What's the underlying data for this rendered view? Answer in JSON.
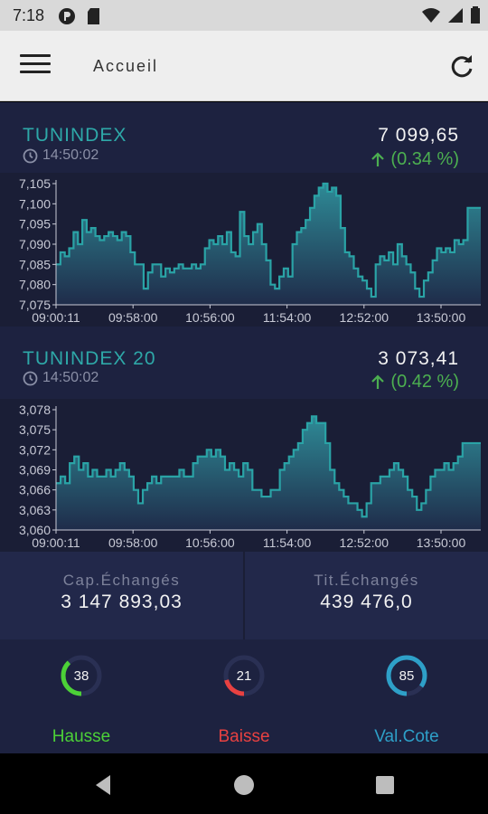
{
  "status_bar": {
    "time": "7:18",
    "icons": [
      "pocket-icon",
      "sd-card-icon",
      "wifi-icon",
      "signal-icon",
      "battery-icon"
    ]
  },
  "app_bar": {
    "title": "Accueil",
    "menu_icon": "menu-icon",
    "refresh_icon": "refresh-icon"
  },
  "indices": [
    {
      "name": "TUNINDEX",
      "time": "14:50:02",
      "value": "7 099,65",
      "change": "(0.34 %)",
      "change_direction": "up",
      "chart_data": {
        "type": "area",
        "x_ticks": [
          "09:00:11",
          "09:58:00",
          "10:56:00",
          "11:54:00",
          "12:52:00",
          "13:50:00"
        ],
        "y_ticks": [
          "7,105",
          "7,100",
          "7,095",
          "7,090",
          "7,085",
          "7,080",
          "7,075"
        ],
        "ylim": [
          7075,
          7105
        ],
        "values": [
          7085,
          7088,
          7087,
          7089,
          7093,
          7090,
          7096,
          7093,
          7094,
          7092,
          7091,
          7092,
          7093,
          7092,
          7091,
          7093,
          7092,
          7088,
          7085,
          7085,
          7079,
          7083,
          7085,
          7085,
          7082,
          7084,
          7083,
          7084,
          7085,
          7084,
          7084,
          7085,
          7084,
          7085,
          7089,
          7091,
          7090,
          7092,
          7090,
          7093,
          7088,
          7087,
          7098,
          7092,
          7090,
          7093,
          7095,
          7090,
          7086,
          7080,
          7079,
          7082,
          7084,
          7082,
          7090,
          7093,
          7094,
          7096,
          7099,
          7102,
          7104,
          7105,
          7103,
          7104,
          7102,
          7094,
          7088,
          7087,
          7084,
          7082,
          7081,
          7079,
          7077,
          7085,
          7087,
          7086,
          7088,
          7085,
          7090,
          7087,
          7085,
          7083,
          7079,
          7077,
          7081,
          7083,
          7086,
          7089,
          7088,
          7089,
          7088,
          7091,
          7090,
          7091,
          7099,
          7099,
          7099,
          7099
        ],
        "color": "#2aa3a6"
      }
    },
    {
      "name": "TUNINDEX 20",
      "time": "14:50:02",
      "value": "3 073,41",
      "change": "(0.42 %)",
      "change_direction": "up",
      "chart_data": {
        "type": "area",
        "x_ticks": [
          "09:00:11",
          "09:58:00",
          "10:56:00",
          "11:54:00",
          "12:52:00",
          "13:50:00"
        ],
        "y_ticks": [
          "3,078",
          "3,075",
          "3,072",
          "3,069",
          "3,066",
          "3,063",
          "3,060"
        ],
        "ylim": [
          3060,
          3078
        ],
        "values": [
          3067,
          3068,
          3067,
          3070,
          3071,
          3069,
          3070,
          3068,
          3069,
          3068,
          3068,
          3069,
          3068,
          3069,
          3070,
          3069,
          3068,
          3066,
          3064,
          3066,
          3067,
          3068,
          3067,
          3068,
          3068,
          3068,
          3068,
          3069,
          3068,
          3068,
          3070,
          3071,
          3071,
          3072,
          3071,
          3072,
          3071,
          3069,
          3070,
          3069,
          3068,
          3070,
          3069,
          3066,
          3066,
          3065,
          3065,
          3066,
          3066,
          3069,
          3070,
          3071,
          3072,
          3073,
          3075,
          3076,
          3077,
          3076,
          3076,
          3073,
          3069,
          3067,
          3066,
          3065,
          3064,
          3064,
          3063,
          3062,
          3064,
          3067,
          3067,
          3068,
          3068,
          3069,
          3070,
          3069,
          3068,
          3066,
          3065,
          3063,
          3064,
          3066,
          3068,
          3069,
          3069,
          3070,
          3069,
          3070,
          3071,
          3073,
          3073,
          3073,
          3073,
          3073
        ],
        "color": "#2aa3a6"
      }
    }
  ],
  "stats": {
    "cap_label": "Cap.Échangés",
    "cap_value": "3 147 893,03",
    "tit_label": "Tit.Échangés",
    "tit_value": "439 476,0"
  },
  "rings": [
    {
      "value": "38",
      "label": "Hausse",
      "color": "#4cd137",
      "fraction": 0.38
    },
    {
      "value": "21",
      "label": "Baisse",
      "color": "#e84141",
      "fraction": 0.21
    },
    {
      "value": "85",
      "label": "Val.Cote",
      "color": "#2ea0c8",
      "fraction": 0.85
    }
  ],
  "nav": {
    "back_icon": "back-icon",
    "home_icon": "home-icon",
    "recents_icon": "recents-icon"
  }
}
